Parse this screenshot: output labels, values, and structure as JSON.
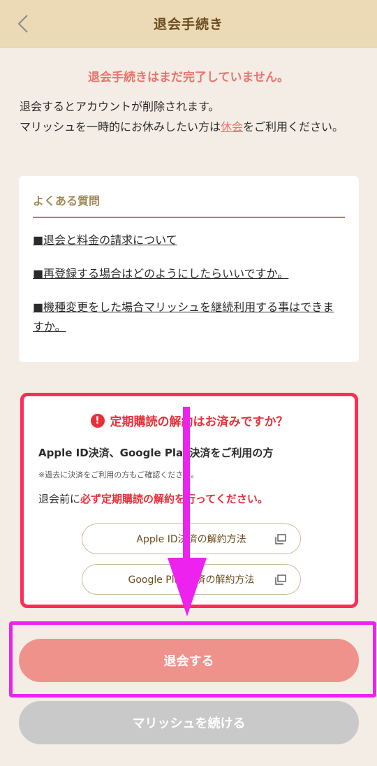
{
  "header": {
    "title": "退会手続き"
  },
  "warning": "退会手続きはまだ完了していません。",
  "intro": {
    "line1": "退会するとアカウントが削除されます。",
    "line2_before": "マリッシュを一時的にお休みしたい方は",
    "line2_link": "休会",
    "line2_after": "をご利用ください。"
  },
  "faq": {
    "title": "よくある質問",
    "links": [
      "■退会と料金の請求について",
      "■再登録する場合はどのようにしたらいいですか。",
      "■機種変更をした場合マリッシュを継続利用する事はできますか。"
    ]
  },
  "subscription": {
    "title": "定期購読の解約はお済みですか？",
    "heading": "Apple ID決済、Google Play決済をご利用の方",
    "note": "※過去に決済をご利用の方もご確認ください。",
    "instruction_before": "退会前に",
    "instruction_highlight": "必ず定期購読の解約を行ってください。",
    "apple_button": "Apple ID決済の解約方法",
    "google_button": "Google Play決済の解約方法"
  },
  "actions": {
    "cancel_label": "退会する",
    "continue_label": "マリッシュを続ける"
  },
  "colors": {
    "accent": "#e8746f",
    "alert_red": "#e8303a",
    "highlight_box": "#ff2d55",
    "annotation_magenta": "#ee22ee",
    "header_bg": "#ecd9b6"
  }
}
